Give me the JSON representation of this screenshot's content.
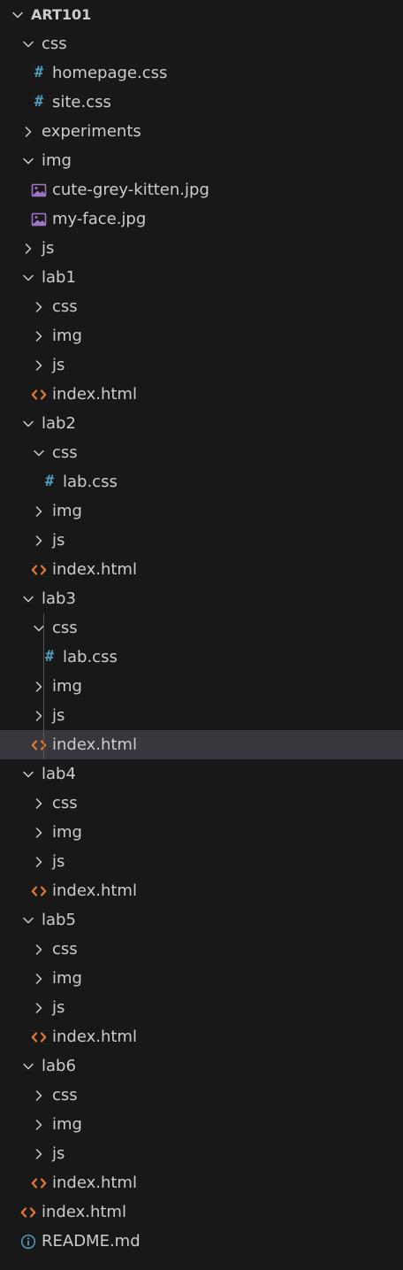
{
  "explorer": {
    "colors": {
      "background": "#181818",
      "text": "#cccccc",
      "selection": "#37373d",
      "css_icon": "#519aba",
      "html_icon": "#e37933",
      "image_icon": "#a074c4",
      "info_icon": "#519aba",
      "chevron": "#cccccc"
    },
    "rows": [
      {
        "label": "ART101",
        "kind": "folder",
        "expanded": true,
        "depth": 0,
        "icon": "chevron-down-icon",
        "root": true
      },
      {
        "label": "css",
        "kind": "folder",
        "expanded": true,
        "depth": 1,
        "icon": "chevron-down-icon"
      },
      {
        "label": "homepage.css",
        "kind": "file",
        "depth": 2,
        "icon": "css-file-icon"
      },
      {
        "label": "site.css",
        "kind": "file",
        "depth": 2,
        "icon": "css-file-icon"
      },
      {
        "label": "experiments",
        "kind": "folder",
        "expanded": false,
        "depth": 1,
        "icon": "chevron-right-icon"
      },
      {
        "label": "img",
        "kind": "folder",
        "expanded": true,
        "depth": 1,
        "icon": "chevron-down-icon"
      },
      {
        "label": "cute-grey-kitten.jpg",
        "kind": "file",
        "depth": 2,
        "icon": "image-file-icon"
      },
      {
        "label": "my-face.jpg",
        "kind": "file",
        "depth": 2,
        "icon": "image-file-icon"
      },
      {
        "label": "js",
        "kind": "folder",
        "expanded": false,
        "depth": 1,
        "icon": "chevron-right-icon"
      },
      {
        "label": "lab1",
        "kind": "folder",
        "expanded": true,
        "depth": 1,
        "icon": "chevron-down-icon"
      },
      {
        "label": "css",
        "kind": "folder",
        "expanded": false,
        "depth": 2,
        "icon": "chevron-right-icon"
      },
      {
        "label": "img",
        "kind": "folder",
        "expanded": false,
        "depth": 2,
        "icon": "chevron-right-icon"
      },
      {
        "label": "js",
        "kind": "folder",
        "expanded": false,
        "depth": 2,
        "icon": "chevron-right-icon"
      },
      {
        "label": "index.html",
        "kind": "file",
        "depth": 2,
        "icon": "html-file-icon"
      },
      {
        "label": "lab2",
        "kind": "folder",
        "expanded": true,
        "depth": 1,
        "icon": "chevron-down-icon"
      },
      {
        "label": "css",
        "kind": "folder",
        "expanded": true,
        "depth": 2,
        "icon": "chevron-down-icon"
      },
      {
        "label": "lab.css",
        "kind": "file",
        "depth": 3,
        "icon": "css-file-icon"
      },
      {
        "label": "img",
        "kind": "folder",
        "expanded": false,
        "depth": 2,
        "icon": "chevron-right-icon"
      },
      {
        "label": "js",
        "kind": "folder",
        "expanded": false,
        "depth": 2,
        "icon": "chevron-right-icon"
      },
      {
        "label": "index.html",
        "kind": "file",
        "depth": 2,
        "icon": "html-file-icon"
      },
      {
        "label": "lab3",
        "kind": "folder",
        "expanded": true,
        "depth": 1,
        "icon": "chevron-down-icon"
      },
      {
        "label": "css",
        "kind": "folder",
        "expanded": true,
        "depth": 2,
        "icon": "chevron-down-icon"
      },
      {
        "label": "lab.css",
        "kind": "file",
        "depth": 3,
        "icon": "css-file-icon"
      },
      {
        "label": "img",
        "kind": "folder",
        "expanded": false,
        "depth": 2,
        "icon": "chevron-right-icon"
      },
      {
        "label": "js",
        "kind": "folder",
        "expanded": false,
        "depth": 2,
        "icon": "chevron-right-icon"
      },
      {
        "label": "index.html",
        "kind": "file",
        "depth": 2,
        "icon": "html-file-icon",
        "selected": true
      },
      {
        "label": "lab4",
        "kind": "folder",
        "expanded": true,
        "depth": 1,
        "icon": "chevron-down-icon"
      },
      {
        "label": "css",
        "kind": "folder",
        "expanded": false,
        "depth": 2,
        "icon": "chevron-right-icon"
      },
      {
        "label": "img",
        "kind": "folder",
        "expanded": false,
        "depth": 2,
        "icon": "chevron-right-icon"
      },
      {
        "label": "js",
        "kind": "folder",
        "expanded": false,
        "depth": 2,
        "icon": "chevron-right-icon"
      },
      {
        "label": "index.html",
        "kind": "file",
        "depth": 2,
        "icon": "html-file-icon"
      },
      {
        "label": "lab5",
        "kind": "folder",
        "expanded": true,
        "depth": 1,
        "icon": "chevron-down-icon"
      },
      {
        "label": "css",
        "kind": "folder",
        "expanded": false,
        "depth": 2,
        "icon": "chevron-right-icon"
      },
      {
        "label": "img",
        "kind": "folder",
        "expanded": false,
        "depth": 2,
        "icon": "chevron-right-icon"
      },
      {
        "label": "js",
        "kind": "folder",
        "expanded": false,
        "depth": 2,
        "icon": "chevron-right-icon"
      },
      {
        "label": "index.html",
        "kind": "file",
        "depth": 2,
        "icon": "html-file-icon"
      },
      {
        "label": "lab6",
        "kind": "folder",
        "expanded": true,
        "depth": 1,
        "icon": "chevron-down-icon"
      },
      {
        "label": "css",
        "kind": "folder",
        "expanded": false,
        "depth": 2,
        "icon": "chevron-right-icon"
      },
      {
        "label": "img",
        "kind": "folder",
        "expanded": false,
        "depth": 2,
        "icon": "chevron-right-icon"
      },
      {
        "label": "js",
        "kind": "folder",
        "expanded": false,
        "depth": 2,
        "icon": "chevron-right-icon"
      },
      {
        "label": "index.html",
        "kind": "file",
        "depth": 2,
        "icon": "html-file-icon"
      },
      {
        "label": "index.html",
        "kind": "file",
        "depth": 1,
        "icon": "html-file-icon"
      },
      {
        "label": "README.md",
        "kind": "file",
        "depth": 1,
        "icon": "info-file-icon"
      }
    ]
  }
}
